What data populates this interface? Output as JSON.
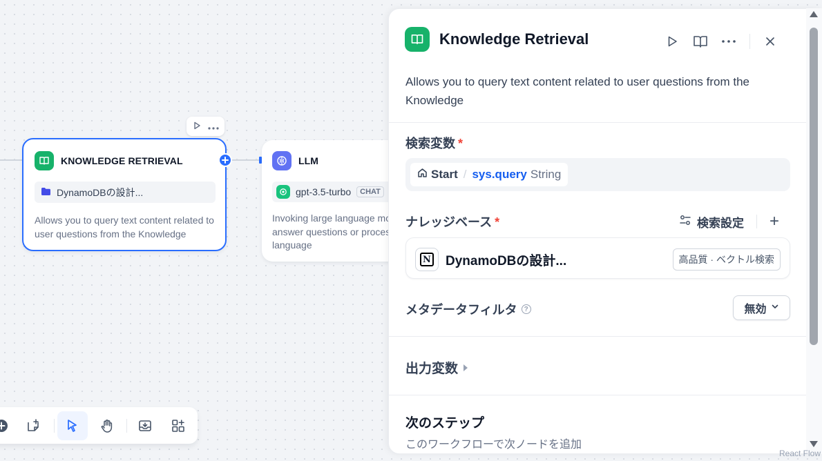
{
  "canvas": {
    "kr_node": {
      "title": "KNOWLEDGE RETRIEVAL",
      "dataset": "DynamoDBの設計...",
      "description": "Allows you to query text content related to user questions from the Knowledge"
    },
    "llm_node": {
      "title": "LLM",
      "model": "gpt-3.5-turbo",
      "model_badge": "CHAT",
      "description": "Invoking large language models to answer questions or process natural language"
    },
    "toolbar_icons": [
      "add-node-icon",
      "note-icon",
      "pointer-icon",
      "hand-icon",
      "export-icon",
      "layout-icon"
    ],
    "attribution": "React Flow"
  },
  "panel": {
    "title": "Knowledge Retrieval",
    "description": "Allows you to query text content related to user questions from the Knowledge",
    "query_variable": {
      "label": "検索変数",
      "required_mark": "*",
      "source": "Start",
      "separator": "/",
      "variable": "sys.query",
      "type": "String"
    },
    "knowledge": {
      "label": "ナレッジベース",
      "required_mark": "*",
      "settings_label": "検索設定",
      "add_label": "+",
      "dataset_name": "DynamoDBの設計...",
      "dataset_badge": "高品質 · ベクトル検索"
    },
    "metadata": {
      "label": "メタデータフィルタ",
      "help": "?",
      "value": "無効"
    },
    "output": {
      "label": "出力変数"
    },
    "next_step": {
      "title": "次のステップ",
      "subtitle": "このワークフローで次ノードを追加"
    }
  },
  "colors": {
    "accent": "#296dff",
    "node_green": "#17b26a",
    "llm_indigo": "#6172f3",
    "required": "#f04438"
  }
}
